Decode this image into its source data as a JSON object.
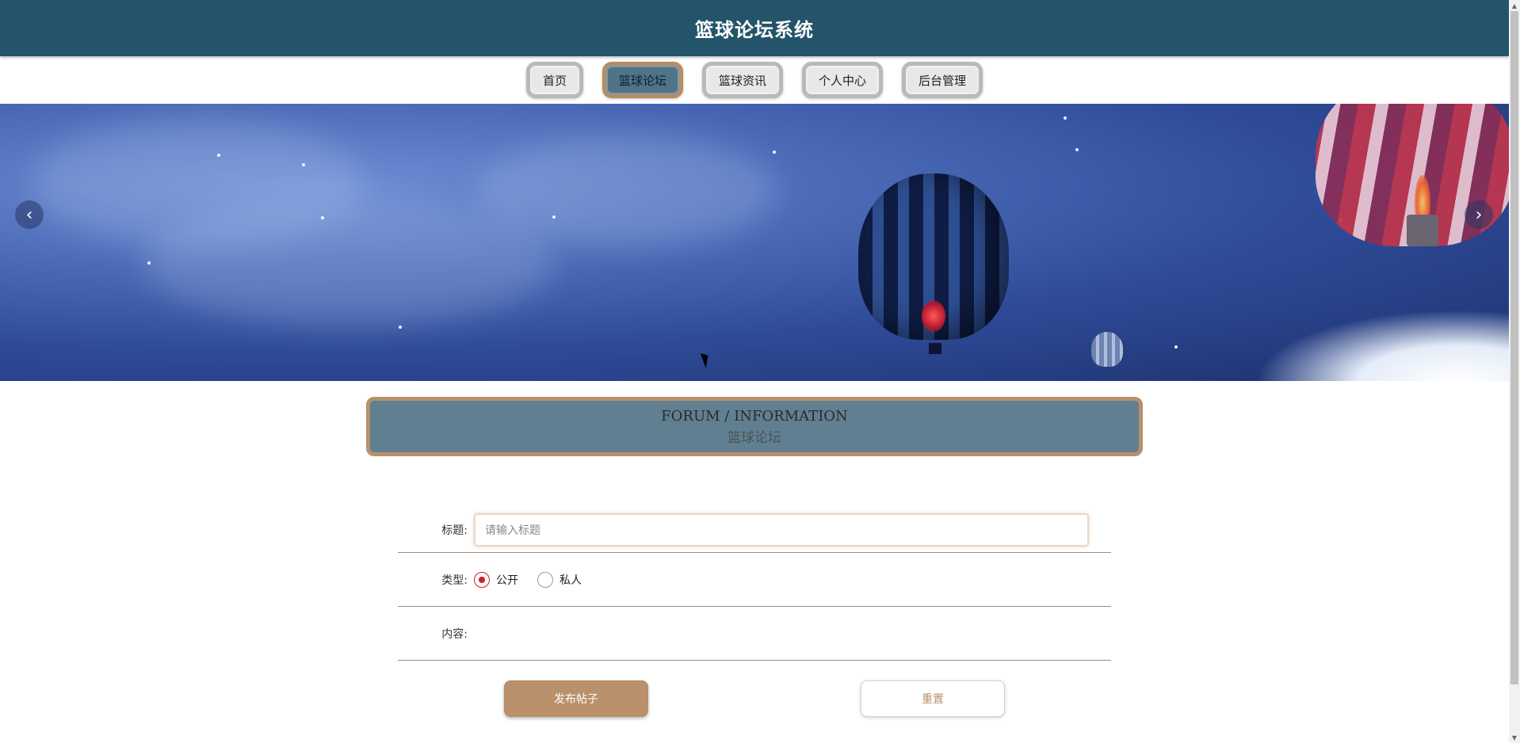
{
  "header": {
    "title": "篮球论坛系统"
  },
  "nav": {
    "items": [
      {
        "label": "首页",
        "active": false
      },
      {
        "label": "篮球论坛",
        "active": true
      },
      {
        "label": "篮球资讯",
        "active": false
      },
      {
        "label": "个人中心",
        "active": false
      },
      {
        "label": "后台管理",
        "active": false
      }
    ]
  },
  "banner": {
    "prev_icon": "chevron-left-icon",
    "next_icon": "chevron-right-icon"
  },
  "section": {
    "title_en": "FORUM / INFORMATION",
    "title_cn": "篮球论坛"
  },
  "form": {
    "title_label": "标题:",
    "title_placeholder": "请输入标题",
    "title_value": "",
    "type_label": "类型:",
    "type_options": [
      {
        "label": "公开",
        "checked": true
      },
      {
        "label": "私人",
        "checked": false
      }
    ],
    "content_label": "内容:",
    "submit_label": "发布帖子",
    "reset_label": "重置"
  },
  "colors": {
    "header": "#235469",
    "accent": "#b8906a",
    "section_bg": "#608092"
  }
}
